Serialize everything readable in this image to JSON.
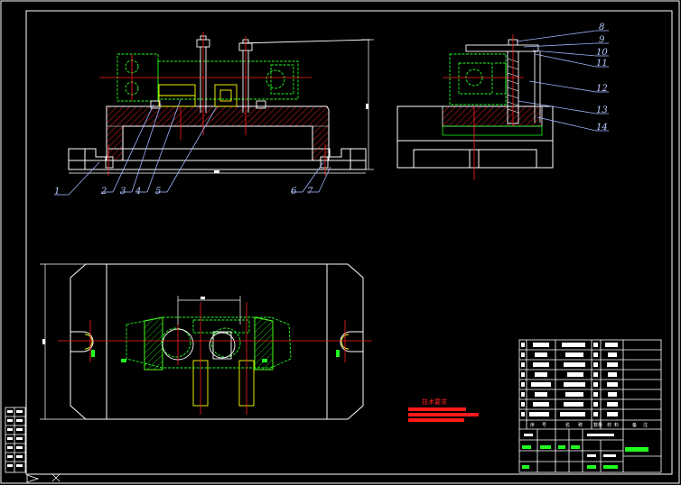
{
  "drawing": {
    "background": "#000000",
    "colors": {
      "frame": "#ffffff",
      "center_line": "#ff2020",
      "part_green": "#20ff20",
      "part_yellow": "#ffff00",
      "leader": "#9fb4ff",
      "dimension": "#ffffff",
      "hatch_red": "#ff1a1a",
      "cyan": "#00ffff"
    }
  },
  "balloons": {
    "front": [
      "1",
      "2",
      "3",
      "4",
      "5",
      "6",
      "7"
    ],
    "side": [
      "8",
      "9",
      "10",
      "11",
      "12",
      "13",
      "14"
    ]
  },
  "technical_notes": {
    "title": "技术要求",
    "line_count": 3
  },
  "title_block": {
    "parts_list_rows": 9,
    "header": [
      "序",
      "号",
      "名",
      "称",
      "数",
      "量",
      "材",
      "料",
      "备",
      "注"
    ]
  },
  "icons": {
    "ucs": "ucs-axis-icon"
  }
}
